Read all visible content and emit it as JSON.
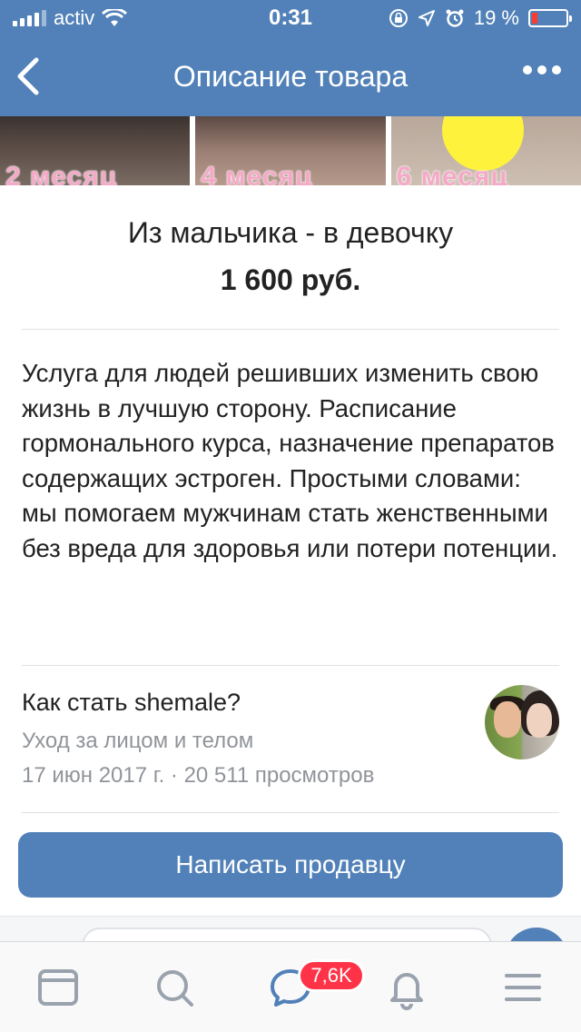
{
  "status_bar": {
    "carrier": "activ",
    "time": "0:31",
    "battery": "19 %"
  },
  "nav": {
    "title": "Описание товара"
  },
  "photos": [
    {
      "caption": "2 месяц"
    },
    {
      "caption": "4 месяц"
    },
    {
      "caption": "6 месяц"
    }
  ],
  "product": {
    "name": "Из мальчика - в девочку",
    "price": "1 600 руб.",
    "description": "Услуга для людей решивших изменить свою жизнь в лучшую сторону. Расписание гормонального курса, назначение препаратов содержащих эстроген. Простыми словами: мы помогаем мужчинам стать женственными без вреда для здоровья или потери потенции."
  },
  "article": {
    "title": "Как стать shemale?",
    "category": "Уход за лицом и телом",
    "meta": "17 июн 2017 г. · 20 511 просмотров"
  },
  "actions": {
    "write_seller": "Написать продавцу"
  },
  "tabbar": {
    "messages_badge": "7,6K",
    "icons": [
      "news-icon",
      "search-icon",
      "messages-icon",
      "notifications-icon",
      "menu-icon"
    ]
  },
  "colors": {
    "accent": "#5181b8",
    "badge": "#ff3347",
    "secondary_text": "#909499"
  }
}
